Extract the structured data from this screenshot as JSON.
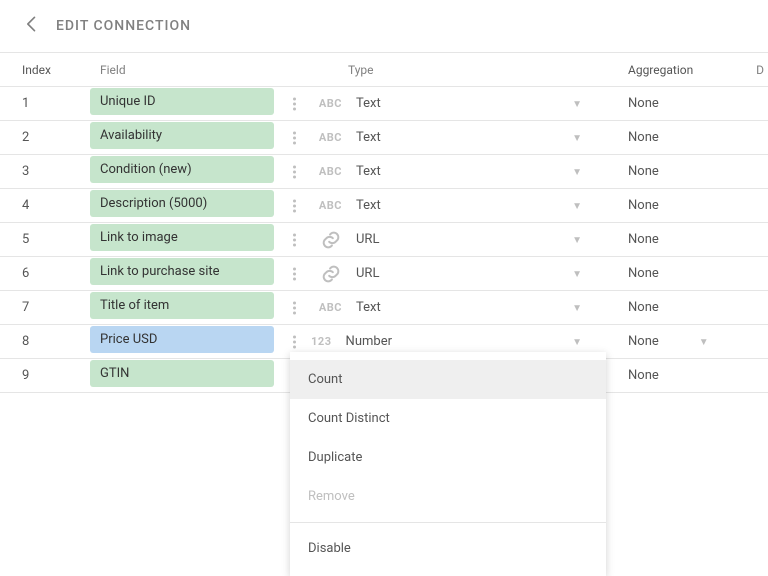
{
  "header": {
    "title": "EDIT CONNECTION"
  },
  "columns": {
    "index": "Index",
    "field": "Field",
    "type": "Type",
    "aggregation": "Aggregation",
    "extra": "D"
  },
  "type_icons": {
    "text": "ABC",
    "url": "link-icon",
    "number": "123"
  },
  "rows": [
    {
      "index": "1",
      "field": "Unique ID",
      "chip": "green",
      "type_icon": "text",
      "type": "Text",
      "agg": "None",
      "agg_caret": false
    },
    {
      "index": "2",
      "field": "Availability",
      "chip": "green",
      "type_icon": "text",
      "type": "Text",
      "agg": "None",
      "agg_caret": false
    },
    {
      "index": "3",
      "field": "Condition (new)",
      "chip": "green",
      "type_icon": "text",
      "type": "Text",
      "agg": "None",
      "agg_caret": false
    },
    {
      "index": "4",
      "field": "Description (5000)",
      "chip": "green",
      "type_icon": "text",
      "type": "Text",
      "agg": "None",
      "agg_caret": false
    },
    {
      "index": "5",
      "field": "Link to image",
      "chip": "green",
      "type_icon": "url",
      "type": "URL",
      "agg": "None",
      "agg_caret": false
    },
    {
      "index": "6",
      "field": "Link to purchase site",
      "chip": "green",
      "type_icon": "url",
      "type": "URL",
      "agg": "None",
      "agg_caret": false
    },
    {
      "index": "7",
      "field": "Title of item",
      "chip": "green",
      "type_icon": "text",
      "type": "Text",
      "agg": "None",
      "agg_caret": false
    },
    {
      "index": "8",
      "field": "Price USD",
      "chip": "blue",
      "type_icon": "number",
      "type": "Number",
      "agg": "None",
      "agg_caret": true
    },
    {
      "index": "9",
      "field": "GTIN",
      "chip": "green",
      "type_icon": "",
      "type": "",
      "agg": "None",
      "agg_caret": false
    }
  ],
  "menu": {
    "items": [
      {
        "label": "Count",
        "state": "hover"
      },
      {
        "label": "Count Distinct",
        "state": "normal"
      },
      {
        "label": "Duplicate",
        "state": "normal"
      },
      {
        "label": "Remove",
        "state": "disabled"
      }
    ],
    "sep_after": 3,
    "last": {
      "label": "Disable",
      "state": "normal"
    }
  }
}
